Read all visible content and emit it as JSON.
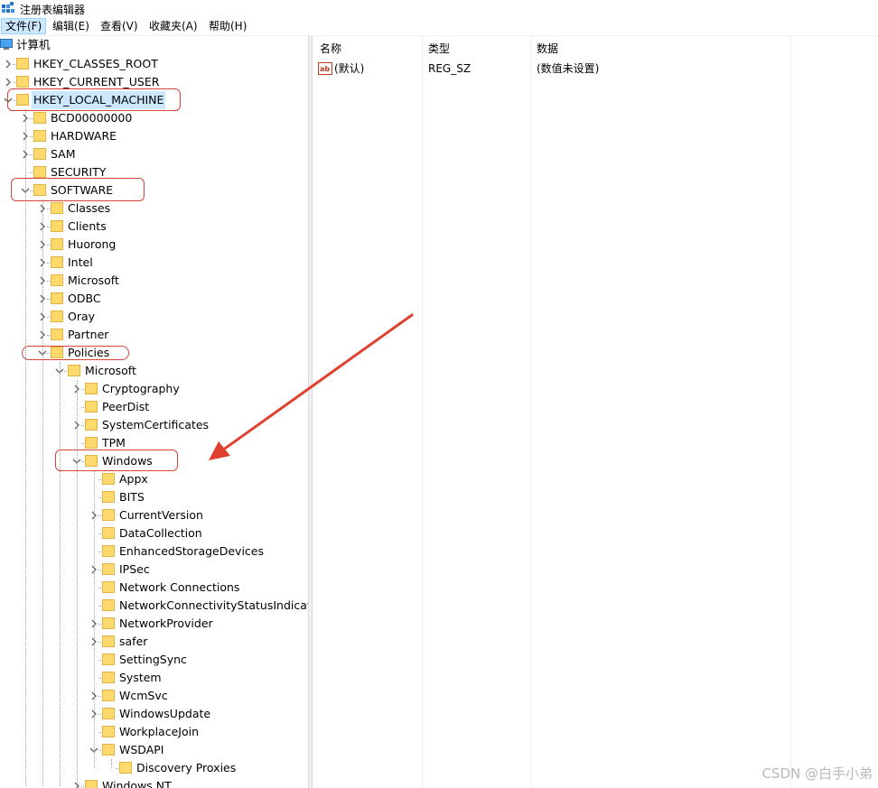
{
  "window": {
    "title": "注册表编辑器"
  },
  "menu": [
    {
      "label": "文件(F)",
      "active": true
    },
    {
      "label": "编辑(E)",
      "active": false
    },
    {
      "label": "查看(V)",
      "active": false
    },
    {
      "label": "收藏夹(A)",
      "active": false
    },
    {
      "label": "帮助(H)",
      "active": false
    }
  ],
  "tree": {
    "root": "计算机",
    "nodes": [
      {
        "label": "HKEY_CLASSES_ROOT",
        "depth": 0,
        "expander": "collapsed"
      },
      {
        "label": "HKEY_CURRENT_USER",
        "depth": 0,
        "expander": "collapsed"
      },
      {
        "label": "HKEY_LOCAL_MACHINE",
        "depth": 0,
        "expander": "expanded",
        "selected": true
      },
      {
        "label": "BCD00000000",
        "depth": 1,
        "expander": "collapsed"
      },
      {
        "label": "HARDWARE",
        "depth": 1,
        "expander": "collapsed"
      },
      {
        "label": "SAM",
        "depth": 1,
        "expander": "collapsed"
      },
      {
        "label": "SECURITY",
        "depth": 1,
        "expander": "none"
      },
      {
        "label": "SOFTWARE",
        "depth": 1,
        "expander": "expanded"
      },
      {
        "label": "Classes",
        "depth": 2,
        "expander": "collapsed"
      },
      {
        "label": "Clients",
        "depth": 2,
        "expander": "collapsed"
      },
      {
        "label": "Huorong",
        "depth": 2,
        "expander": "collapsed"
      },
      {
        "label": "Intel",
        "depth": 2,
        "expander": "collapsed"
      },
      {
        "label": "Microsoft",
        "depth": 2,
        "expander": "collapsed"
      },
      {
        "label": "ODBC",
        "depth": 2,
        "expander": "collapsed"
      },
      {
        "label": "Oray",
        "depth": 2,
        "expander": "collapsed"
      },
      {
        "label": "Partner",
        "depth": 2,
        "expander": "collapsed"
      },
      {
        "label": "Policies",
        "depth": 2,
        "expander": "expanded"
      },
      {
        "label": "Microsoft",
        "depth": 3,
        "expander": "expanded"
      },
      {
        "label": "Cryptography",
        "depth": 4,
        "expander": "collapsed"
      },
      {
        "label": "PeerDist",
        "depth": 4,
        "expander": "none"
      },
      {
        "label": "SystemCertificates",
        "depth": 4,
        "expander": "collapsed"
      },
      {
        "label": "TPM",
        "depth": 4,
        "expander": "none"
      },
      {
        "label": "Windows",
        "depth": 4,
        "expander": "expanded"
      },
      {
        "label": "Appx",
        "depth": 5,
        "expander": "none"
      },
      {
        "label": "BITS",
        "depth": 5,
        "expander": "none"
      },
      {
        "label": "CurrentVersion",
        "depth": 5,
        "expander": "collapsed"
      },
      {
        "label": "DataCollection",
        "depth": 5,
        "expander": "none"
      },
      {
        "label": "EnhancedStorageDevices",
        "depth": 5,
        "expander": "none"
      },
      {
        "label": "IPSec",
        "depth": 5,
        "expander": "collapsed"
      },
      {
        "label": "Network Connections",
        "depth": 5,
        "expander": "none"
      },
      {
        "label": "NetworkConnectivityStatusIndicator",
        "depth": 5,
        "expander": "none"
      },
      {
        "label": "NetworkProvider",
        "depth": 5,
        "expander": "collapsed"
      },
      {
        "label": "safer",
        "depth": 5,
        "expander": "collapsed"
      },
      {
        "label": "SettingSync",
        "depth": 5,
        "expander": "none"
      },
      {
        "label": "System",
        "depth": 5,
        "expander": "none"
      },
      {
        "label": "WcmSvc",
        "depth": 5,
        "expander": "collapsed"
      },
      {
        "label": "WindowsUpdate",
        "depth": 5,
        "expander": "collapsed"
      },
      {
        "label": "WorkplaceJoin",
        "depth": 5,
        "expander": "none"
      },
      {
        "label": "WSDAPI",
        "depth": 5,
        "expander": "expanded"
      },
      {
        "label": "Discovery Proxies",
        "depth": 6,
        "expander": "none"
      },
      {
        "label": "Windows NT",
        "depth": 4,
        "expander": "collapsed"
      }
    ]
  },
  "list": {
    "columns": [
      "名称",
      "类型",
      "数据"
    ],
    "rows": [
      {
        "icon": "string-value-icon",
        "name": "(默认)",
        "type": "REG_SZ",
        "data": "(数值未设置)"
      }
    ]
  },
  "annotation_color": "#d9433a",
  "watermark": "CSDN @白手小弟"
}
